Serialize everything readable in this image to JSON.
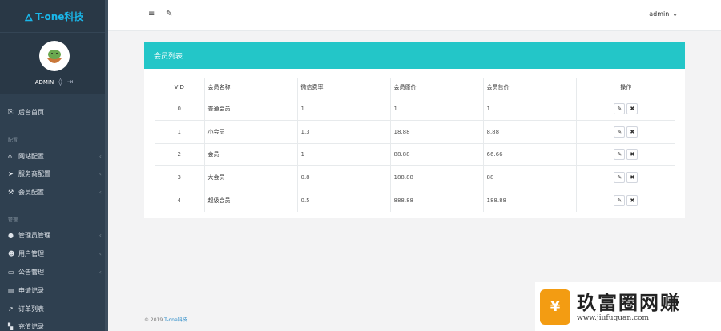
{
  "sidebar": {
    "brand": "T-one科技",
    "user": "ADMIN",
    "home": "后台首页",
    "section_config": "配置",
    "config_items": [
      "网站配置",
      "服务商配置",
      "会员配置"
    ],
    "section_manage": "管理",
    "manage_items": [
      "管理员管理",
      "用户管理",
      "公告管理",
      "申请记录",
      "订单列表",
      "充值记录"
    ]
  },
  "topbar": {
    "user": "admin"
  },
  "panel": {
    "title": "会员列表"
  },
  "table": {
    "columns": [
      "VID",
      "会员名称",
      "微信费率",
      "会员原价",
      "会员售价",
      "操作"
    ],
    "rows": [
      [
        "0",
        "普通会员",
        "1",
        "1",
        "1"
      ],
      [
        "1",
        "小会员",
        "1.3",
        "18.88",
        "8.88"
      ],
      [
        "2",
        "会员",
        "1",
        "88.88",
        "66.66"
      ],
      [
        "3",
        "大会员",
        "0.8",
        "188.88",
        "88"
      ],
      [
        "4",
        "超级会员",
        "0.5",
        "888.88",
        "188.88"
      ]
    ]
  },
  "footer": {
    "copyright": "© 2019 ",
    "brand": "T-one科技"
  },
  "watermark": {
    "logo_char": "¥",
    "text": "玖富圈网赚",
    "url": "www.jiufuquan.com"
  },
  "colors": {
    "sidebar": "#2f4050",
    "panel_header": "#23c6c8",
    "brand": "#1ab7ea"
  }
}
